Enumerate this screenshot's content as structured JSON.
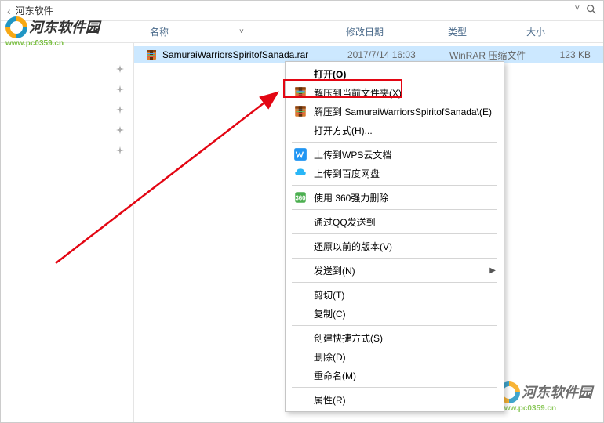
{
  "titlebar": {
    "back_arrow": "‹",
    "title": "河东软件",
    "dropdown": "˅",
    "search": "🔍"
  },
  "logo": {
    "name": "河东软件园",
    "url": "www.pc0359.cn"
  },
  "columns": {
    "name": "名称",
    "sort_indicator": "˅",
    "date": "修改日期",
    "type": "类型",
    "size": "大小"
  },
  "pins": [
    "📌",
    "📌",
    "📌",
    "📌",
    "📌"
  ],
  "file": {
    "name": "SamuraiWarriorsSpiritofSanada.rar",
    "date": "2017/7/14 16:03",
    "type": "WinRAR 压缩文件",
    "size": "123 KB"
  },
  "context_menu": {
    "open": "打开(O)",
    "extract_here": "解压到当前文件夹(X)",
    "extract_to": "解压到 SamuraiWarriorsSpiritofSanada\\(E)",
    "open_with": "打开方式(H)...",
    "upload_wps": "上传到WPS云文档",
    "upload_baidu": "上传到百度网盘",
    "delete_360": "使用 360强力删除",
    "qq_send": "通过QQ发送到",
    "restore": "还原以前的版本(V)",
    "send_to": "发送到(N)",
    "cut": "剪切(T)",
    "copy": "复制(C)",
    "shortcut": "创建快捷方式(S)",
    "delete": "删除(D)",
    "rename": "重命名(M)",
    "properties": "属性(R)"
  }
}
